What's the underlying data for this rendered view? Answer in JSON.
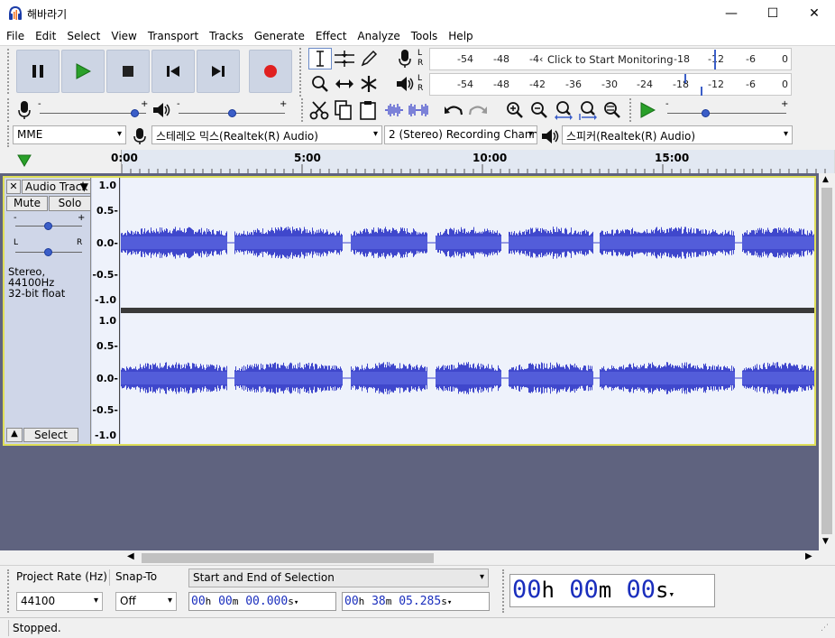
{
  "window": {
    "title": "해바라기",
    "minimize": "—",
    "maximize": "☐",
    "close": "✕"
  },
  "menu": [
    "File",
    "Edit",
    "Select",
    "View",
    "Transport",
    "Tracks",
    "Generate",
    "Effect",
    "Analyze",
    "Tools",
    "Help"
  ],
  "meters": {
    "record_ticks": [
      "-54",
      "-48",
      "-4‹",
      "-18",
      "-12",
      "-6",
      "0"
    ],
    "record_prompt": "Click to Start Monitoring",
    "play_ticks": [
      "-54",
      "-48",
      "-42",
      "-36",
      "-30",
      "-24",
      "-18",
      "-12",
      "-6",
      "0"
    ],
    "lr": [
      "L",
      "R"
    ]
  },
  "sliders": {
    "rec_minus": "-",
    "rec_plus": "+",
    "play_minus": "-",
    "play_plus": "+",
    "speed_minus": "-",
    "speed_plus": "+"
  },
  "devices": {
    "host": "MME",
    "rec_device": "스테레오 믹스(Realtek(R) Audio)",
    "rec_channels": "2 (Stereo) Recording Chann",
    "play_device": "스피커(Realtek(R) Audio)"
  },
  "timeline": {
    "ticks": [
      "0:00",
      "5:00",
      "10:00",
      "15:00"
    ]
  },
  "track": {
    "name": "Audio Track",
    "close": "✕",
    "mute": "Mute",
    "solo": "Solo",
    "gain_minus": "-",
    "gain_plus": "+",
    "pan_l": "L",
    "pan_r": "R",
    "info1": "Stereo, 44100Hz",
    "info2": "32-bit float",
    "select": "Select",
    "scale": [
      "1.0",
      "0.5-",
      "0.0-",
      "-0.5-",
      "-1.0"
    ]
  },
  "selection": {
    "rate_label": "Project Rate (Hz)",
    "rate_value": "44100",
    "snap_label": "Snap-To",
    "snap_value": "Off",
    "mode": "Start and End of Selection",
    "start": {
      "h": "00",
      "m": "00",
      "s": "00.000"
    },
    "end": {
      "h": "00",
      "m": "38",
      "s": "05.285"
    },
    "units": {
      "h": "h",
      "m": "m",
      "s": "s"
    },
    "big": {
      "h": "00",
      "m": "00",
      "s": "00"
    }
  },
  "status": "Stopped.",
  "colors": {
    "wave": "#3f47cc",
    "record": "#e02020",
    "play": "#2aa02a",
    "track_bg": "#eef2fb",
    "selection_border": "#dede58"
  }
}
